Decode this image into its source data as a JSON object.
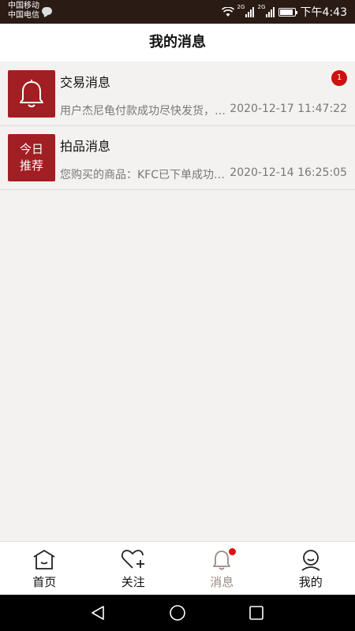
{
  "status_bar": {
    "carrier1": "中国移动",
    "carrier2": "中国电信",
    "network1": "2G",
    "network2": "2G",
    "time": "下午4:43"
  },
  "header": {
    "title": "我的消息"
  },
  "messages": [
    {
      "title": "交易消息",
      "preview": "用户杰尼龟付款成功尽快发货，请及时处理",
      "time": "2020-12-17 11:47:22",
      "badge": "1",
      "icon": "bell-icon"
    },
    {
      "title": "拍品消息",
      "preview": "您购买的商品：KFC已下单成功，请尽快付款",
      "time": "2020-12-14 16:25:05",
      "thumb_line1": "今日",
      "thumb_line2": "推荐"
    }
  ],
  "tabs": [
    {
      "label": "首页",
      "icon": "home-icon"
    },
    {
      "label": "关注",
      "icon": "heart-plus-icon"
    },
    {
      "label": "消息",
      "icon": "bell-icon",
      "active": true
    },
    {
      "label": "我的",
      "icon": "user-icon"
    }
  ],
  "colors": {
    "accent": "#a11e22",
    "badge": "#cc1111",
    "status_bar": "#2a1b14",
    "active_tab": "#9b8a83"
  }
}
